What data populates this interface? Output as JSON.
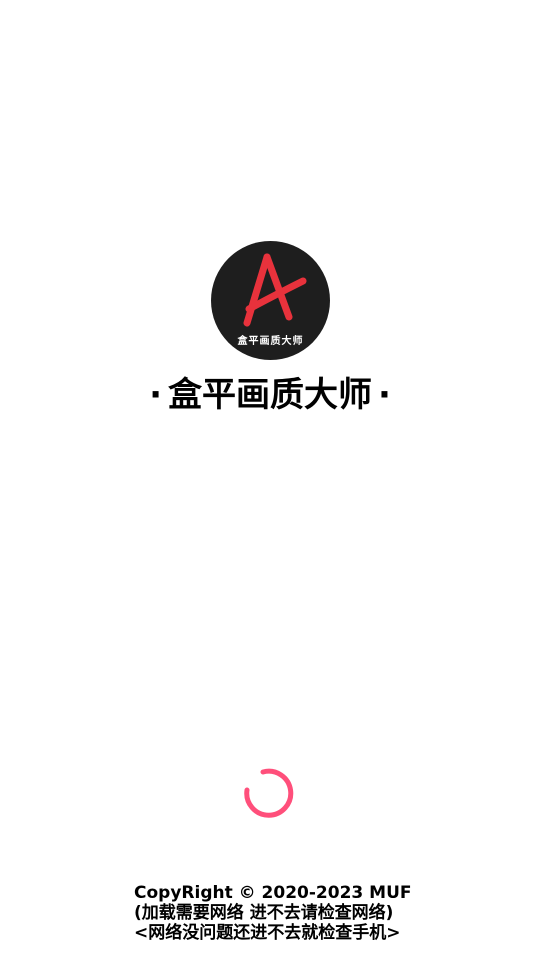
{
  "splash": {
    "logo_caption": "盒平画质大师",
    "title": "盒平画质大师",
    "title_decoration": "·"
  },
  "loading": {
    "spinner_color": "#ff4f7b"
  },
  "footer": {
    "copyright": "CopyRight © 2020-2023 MUF",
    "note_network": "(加载需要网络 进不去请检查网络)",
    "note_phone": "<网络没问题还进不去就检查手机>"
  },
  "colors": {
    "background": "#ffffff",
    "logo_background": "#1e1e1e",
    "logo_mark": "#e8323c",
    "spinner": "#ff4f7b"
  },
  "icons": {
    "logo": "letter-a-logo-icon",
    "spinner": "loading-spinner-icon"
  }
}
